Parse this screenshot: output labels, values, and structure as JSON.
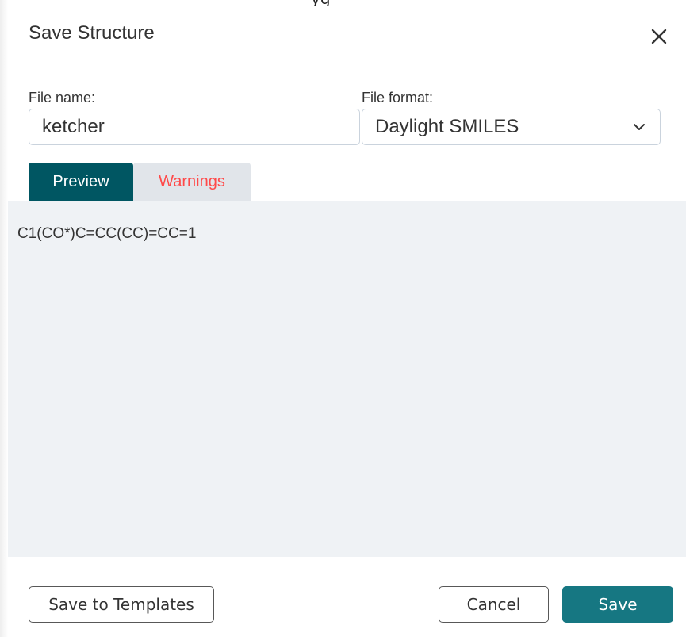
{
  "behind": {
    "fragment_text": "yg"
  },
  "dialog": {
    "title": "Save Structure",
    "close_icon": "close-icon"
  },
  "form": {
    "file_name_label": "File name:",
    "file_name_value": "ketcher",
    "file_format_label": "File format:",
    "file_format_value": "Daylight SMILES"
  },
  "tabs": [
    {
      "label": "Preview",
      "active": true
    },
    {
      "label": "Warnings",
      "active": false
    }
  ],
  "preview": {
    "content": "C1(CO*)C=CC(CC)=CC=1"
  },
  "footer": {
    "save_to_templates_label": "Save to Templates",
    "cancel_label": "Cancel",
    "save_label": "Save"
  },
  "colors": {
    "accent": "#167782",
    "tab_active": "#005662",
    "warning_text": "#ff4a4a",
    "preview_background": "#eff2f5"
  }
}
